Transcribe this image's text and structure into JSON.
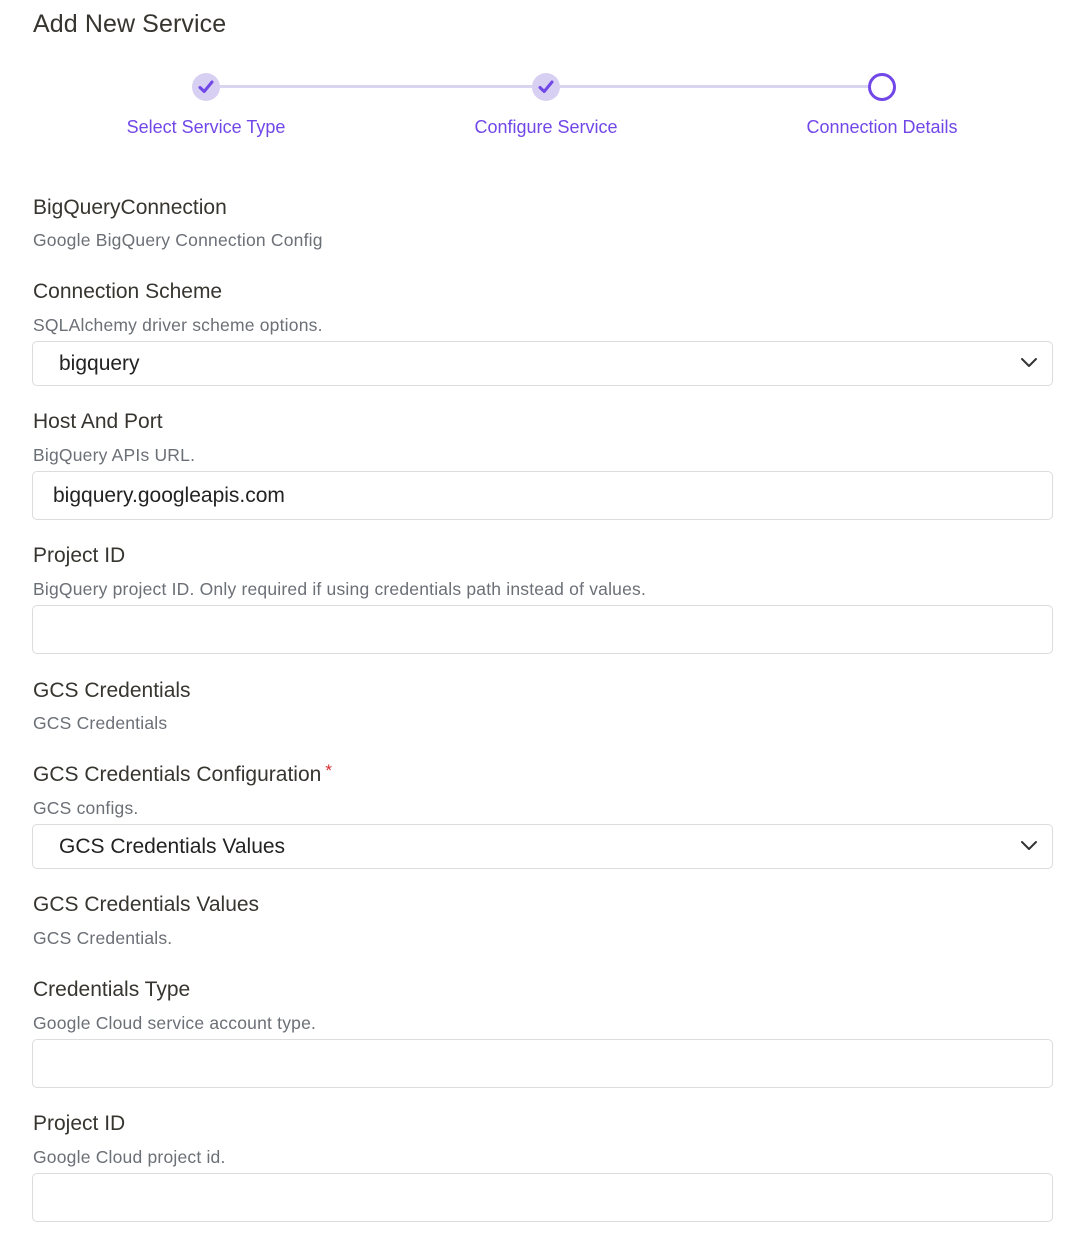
{
  "page": {
    "title": "Add New Service"
  },
  "stepper": {
    "steps": [
      {
        "label": "Select Service Type",
        "state": "completed"
      },
      {
        "label": "Configure Service",
        "state": "completed"
      },
      {
        "label": "Connection Details",
        "state": "active"
      }
    ]
  },
  "section": {
    "title": "BigQueryConnection",
    "description": "Google BigQuery Connection Config"
  },
  "fields": {
    "connection_scheme": {
      "label": "Connection Scheme",
      "help": "SQLAlchemy driver scheme options.",
      "value": "bigquery"
    },
    "host_and_port": {
      "label": "Host And Port",
      "help": "BigQuery APIs URL.",
      "value": "bigquery.googleapis.com"
    },
    "project_id": {
      "label": "Project ID",
      "help": "BigQuery project ID. Only required if using credentials path instead of values.",
      "value": ""
    },
    "gcs_credentials": {
      "label": "GCS Credentials",
      "help": "GCS Credentials"
    },
    "gcs_credentials_configuration": {
      "label": "GCS Credentials Configuration",
      "required_marker": "*",
      "help": "GCS configs.",
      "value": "GCS Credentials Values"
    },
    "gcs_credentials_values": {
      "label": "GCS Credentials Values",
      "help": "GCS Credentials."
    },
    "credentials_type": {
      "label": "Credentials Type",
      "help": "Google Cloud service account type.",
      "value": ""
    },
    "gcp_project_id": {
      "label": "Project ID",
      "help": "Google Cloud project id.",
      "value": ""
    }
  },
  "colors": {
    "accent": "#7147e8",
    "step_done_bg": "#d8d0f2",
    "step_line": "#d9d4ef",
    "required": "#d92a2a"
  },
  "icons": {
    "step_done": "check-icon",
    "select_arrow": "chevron-down-icon"
  }
}
